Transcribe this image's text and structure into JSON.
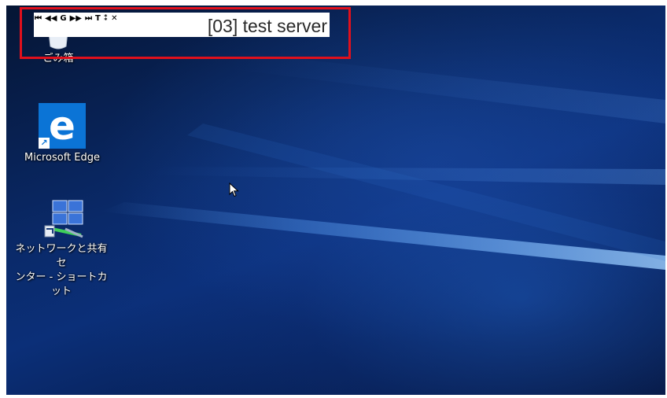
{
  "remote_toolbar": {
    "buttons": [
      {
        "name": "skip-to-start-icon",
        "glyph": "⏮"
      },
      {
        "name": "rewind-icon",
        "glyph": "◀◀"
      },
      {
        "name": "refresh-icon",
        "glyph": "G"
      },
      {
        "name": "fast-forward-icon",
        "glyph": "▶▶"
      },
      {
        "name": "skip-to-end-icon",
        "glyph": "⏭"
      },
      {
        "name": "pin-icon",
        "glyph": "T"
      },
      {
        "name": "minimize-icon",
        "glyph": "⁑"
      },
      {
        "name": "close-icon",
        "glyph": "✕"
      }
    ],
    "title": "[03] test server"
  },
  "desktop_icons": {
    "recycle_bin": {
      "label": "ごみ箱"
    },
    "edge": {
      "label": "Microsoft Edge",
      "glyph": "e"
    },
    "network": {
      "label": "ネットワークと共有セ\nンター - ショートカット"
    }
  },
  "colors": {
    "highlight_box": "#e0101c",
    "desktop_bg": "#0b2f78",
    "edge_tile": "#0b74d6"
  }
}
